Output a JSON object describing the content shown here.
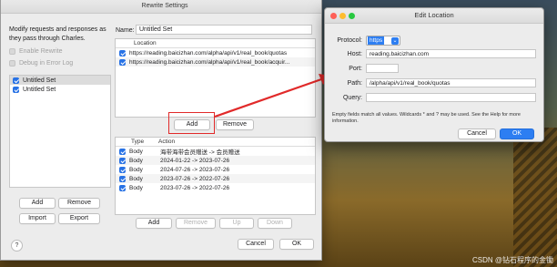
{
  "main_window": {
    "title": "Rewrite Settings",
    "description": "Modify requests and responses as they pass through Charles.",
    "enable_rewrite": "Enable Rewrite",
    "debug_in_error_log": "Debug in Error Log",
    "sets": [
      {
        "label": "Untitled Set",
        "checked": true
      },
      {
        "label": "Untitled Set",
        "checked": true
      }
    ],
    "add_label": "Add",
    "remove_label": "Remove",
    "import_label": "Import",
    "export_label": "Export",
    "help_label": "?",
    "name_label": "Name:",
    "name_value": "Untitled Set",
    "location_header": "Location",
    "locations": [
      {
        "url": "https://reading.baicizhan.com/alpha/api/v1/real_book/quotas",
        "checked": true
      },
      {
        "url": "https://reading.baicizhan.com/alpha/api/v1/real_book/acquir...",
        "checked": true
      }
    ],
    "loc_add_label": "Add",
    "loc_remove_label": "Remove",
    "rules_headers": {
      "type": "Type",
      "action": "Action"
    },
    "rules": [
      {
        "type": "Body",
        "action": "海带海带会员赠送 -> 会员赠送",
        "checked": true
      },
      {
        "type": "Body",
        "action": "2024-01-22 -> 2023-07-26",
        "checked": true
      },
      {
        "type": "Body",
        "action": "2024-07-26 -> 2023-07-26",
        "checked": true
      },
      {
        "type": "Body",
        "action": "2023-07-26 -> 2022-07-26",
        "checked": true
      },
      {
        "type": "Body",
        "action": "2023-07-26 -> 2022-07-26",
        "checked": true
      }
    ],
    "rule_buttons": {
      "add": "Add",
      "remove": "Remove",
      "up": "Up",
      "down": "Down"
    },
    "cancel_label": "Cancel",
    "ok_label": "OK"
  },
  "edit_dialog": {
    "title": "Edit Location",
    "protocol_label": "Protocol:",
    "protocol_value": "https",
    "host_label": "Host:",
    "host_value": "reading.baicizhan.com",
    "port_label": "Port:",
    "port_value": "",
    "path_label": "Path:",
    "path_value": "/alpha/api/v1/real_book/quotas",
    "query_label": "Query:",
    "query_value": "",
    "hint": "Empty fields match all values. Wildcards * and ? may be used. See the Help for more information.",
    "cancel_label": "Cancel",
    "ok_label": "OK"
  },
  "watermark": "CSDN @钻石程序的金锄",
  "colors": {
    "accent": "#2d7ef2",
    "highlight": "#e12a2a"
  }
}
